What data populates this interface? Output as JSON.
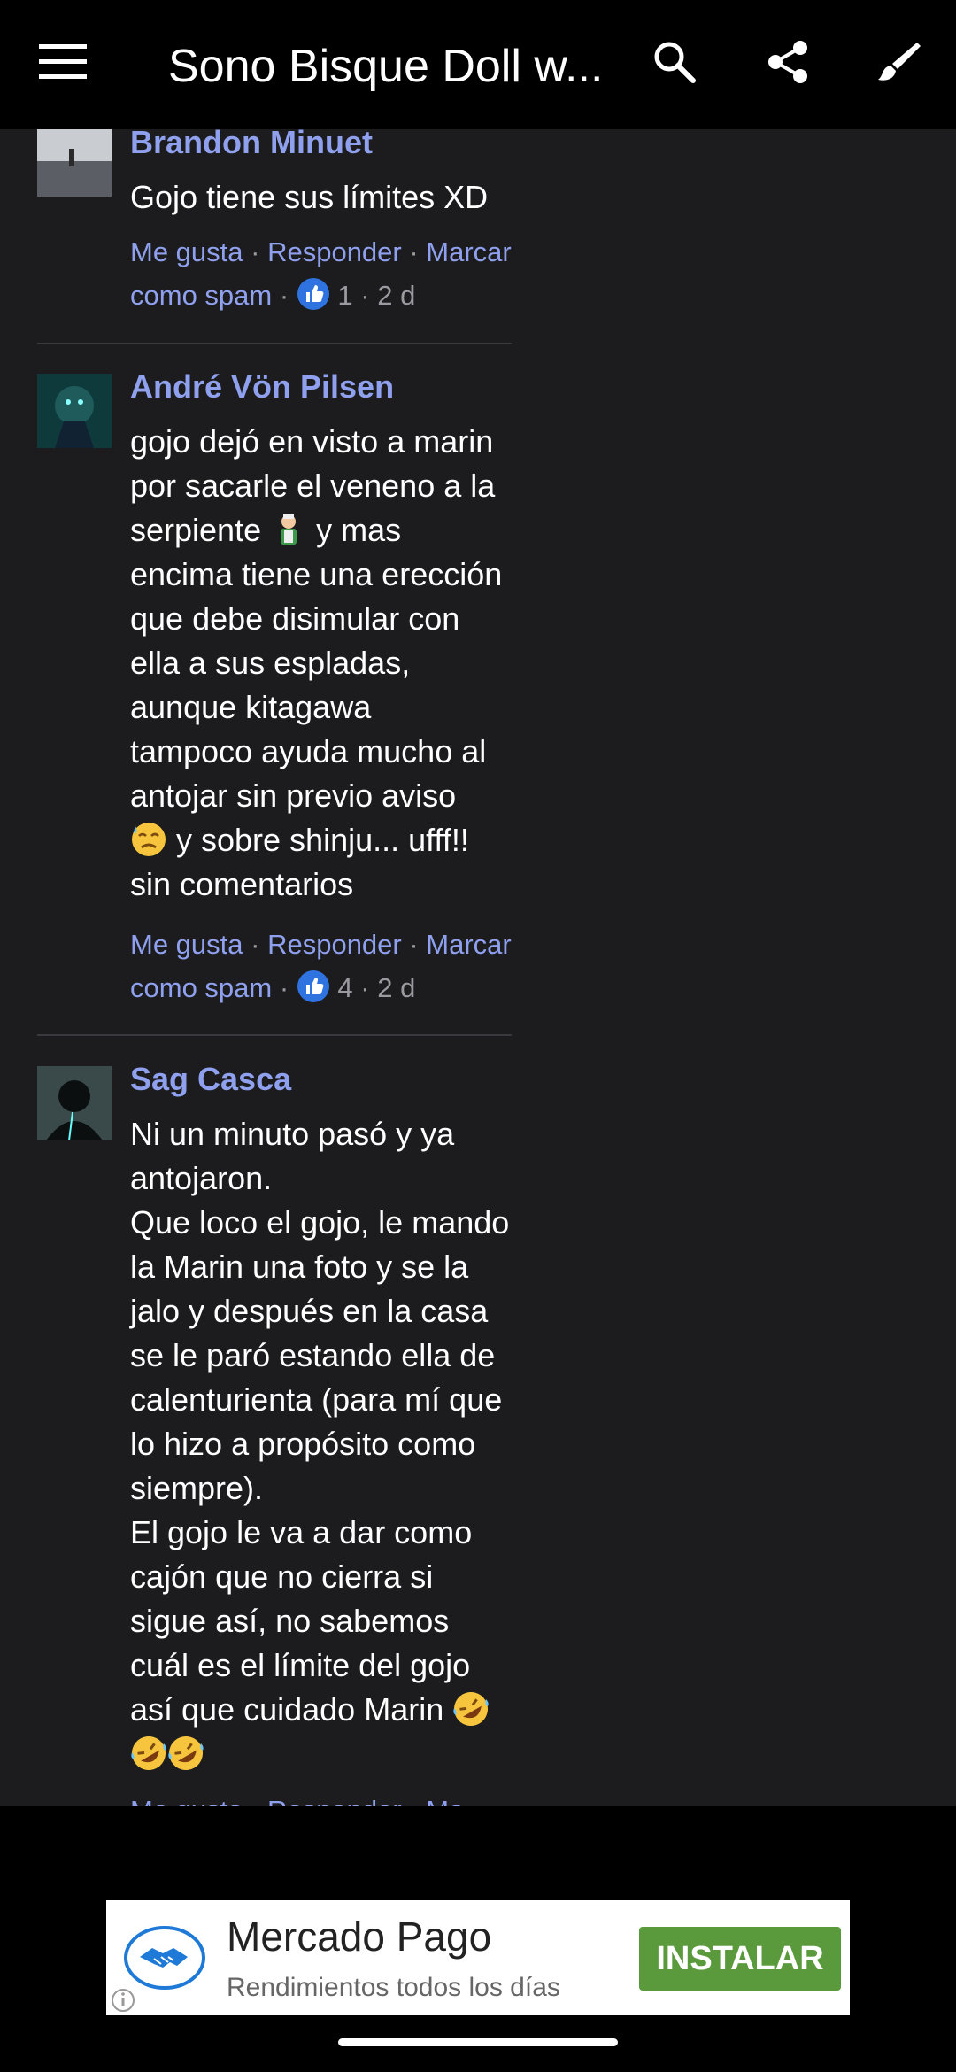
{
  "app_bar": {
    "title": "Sono Bisque Doll w...",
    "icons": [
      "menu-icon",
      "search-icon",
      "share-icon",
      "brush-icon"
    ]
  },
  "comments": [
    {
      "author": "Brandon Minuet",
      "lines": [
        "Gojo tiene sus límites XD"
      ],
      "actions": {
        "like": "Me gusta",
        "reply": "Responder",
        "spam_1": "Marcar",
        "spam_2": "como spam"
      },
      "likes": "1",
      "age": "2 d"
    },
    {
      "author": "André Vön Pilsen",
      "lines": [
        "gojo dejó en visto a marin",
        "por sacarle el veneno a la",
        "serpiente",
        " y mas",
        "encima tiene una erección",
        "que debe disimular con",
        "ella a sus espladas,",
        "aunque kitagawa",
        "tampoco ayuda mucho al",
        "antojar sin previo aviso",
        " y sobre shinju... ufff!!",
        "sin comentarios"
      ],
      "actions": {
        "like": "Me gusta",
        "reply": "Responder",
        "spam_1": "Marcar",
        "spam_2": "como spam"
      },
      "likes": "4",
      "age": "2 d"
    },
    {
      "author": "Sag Casca",
      "lines": [
        "Ni un minuto pasó y ya",
        "antojaron.",
        "Que loco el gojo, le mando",
        "la Marin una foto y se la",
        "jalo y después en la casa",
        "se le paró estando ella de",
        "calenturienta (para mí que",
        "lo hizo a propósito como",
        "siempre).",
        "El gojo le va a dar como",
        "cajón que no cierra si",
        "sigue así, no sabemos",
        "cuál es el límite del gojo",
        "así que cuidado Marin"
      ],
      "actions_partial": "Me gusta · Responder · Ma"
    }
  ],
  "ad": {
    "name": "Mercado Pago",
    "subtitle": "Rendimientos todos los días",
    "cta": "INSTALAR"
  },
  "colors": {
    "background": "#1c1c1e",
    "link": "#8fa0ee",
    "install_button": "#5b9a3c"
  }
}
